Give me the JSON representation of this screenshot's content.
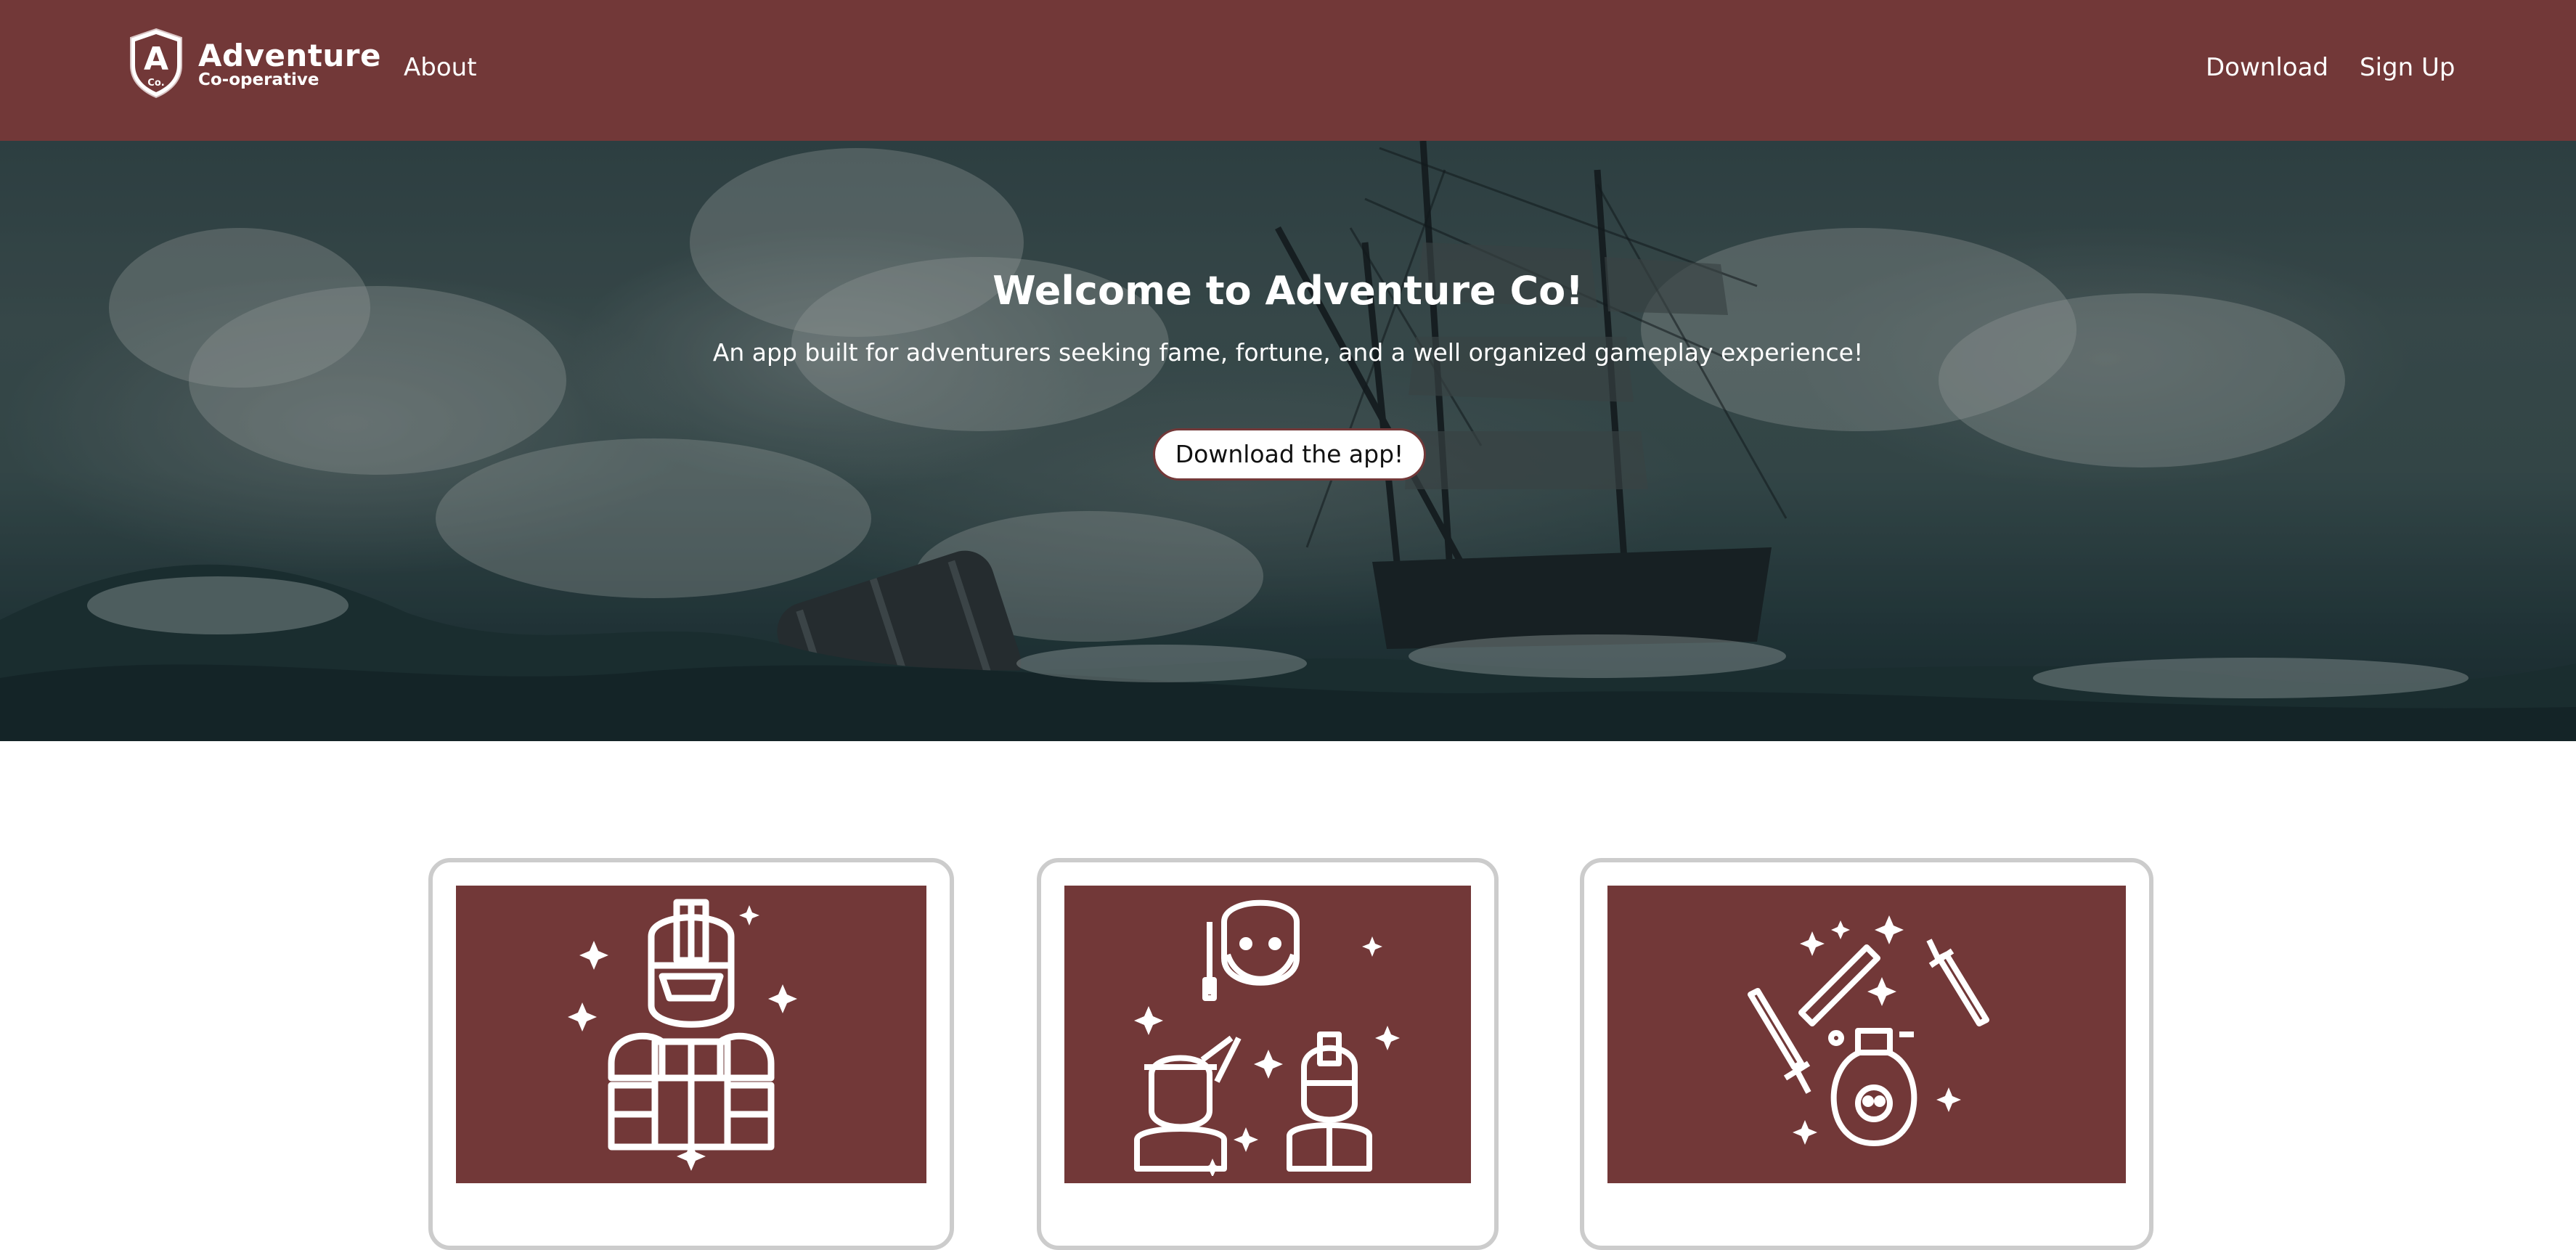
{
  "colors": {
    "brand": "#723838",
    "card_border": "#cccccc",
    "text_on_brand": "#ffffff"
  },
  "navbar": {
    "logo_letter": "A",
    "logo_badge": "Co.",
    "brand_name": "Adventure",
    "brand_subtitle": "Co-operative",
    "links": {
      "about": "About",
      "download": "Download",
      "sign_up": "Sign Up"
    }
  },
  "hero": {
    "title": "Welcome to Adventure Co!",
    "subtitle": "An app built for adventurers seeking fame, fortune, and a well organized gameplay experience!",
    "cta_label": "Download the app!"
  },
  "cards": [
    {
      "icon": "knight-icon"
    },
    {
      "icon": "adventurer-party-icon"
    },
    {
      "icon": "weapons-potion-icon"
    }
  ]
}
